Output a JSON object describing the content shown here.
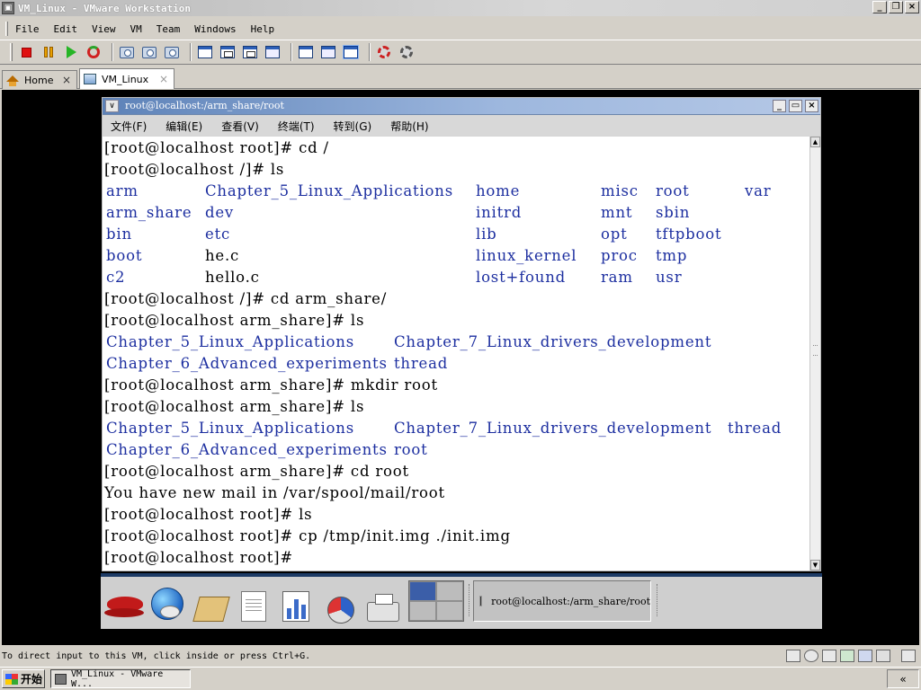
{
  "window": {
    "title": "VM_Linux - VMware Workstation",
    "controls": [
      "_",
      "❐",
      "×"
    ]
  },
  "menu": [
    {
      "id": "file",
      "label": "File"
    },
    {
      "id": "edit",
      "label": "Edit"
    },
    {
      "id": "view",
      "label": "View"
    },
    {
      "id": "vm",
      "label": "VM"
    },
    {
      "id": "team",
      "label": "Team"
    },
    {
      "id": "windows",
      "label": "Windows"
    },
    {
      "id": "help",
      "label": "Help"
    }
  ],
  "toolbar": {
    "icons": [
      "stop-icon",
      "pause-icon",
      "play-icon",
      "reset-icon",
      "snapshot-icon",
      "revert-snapshot-icon",
      "snapshot-manager-icon",
      "normal-view-icon",
      "full-screen-icon",
      "unity-icon",
      "quick-switch-icon",
      "console-view-icon",
      "summary-view-icon",
      "appliance-view-icon",
      "settings-icon",
      "team-settings-icon"
    ]
  },
  "tabs": [
    {
      "id": "home",
      "label": "Home",
      "close": "×"
    },
    {
      "id": "vm-linux",
      "label": "VM_Linux",
      "close": "×"
    }
  ],
  "guest": {
    "terminal": {
      "title": "root@localhost:/arm_share/root",
      "menu_button": "∨",
      "controls": [
        "_",
        "▭",
        "×"
      ],
      "menu": [
        "文件(F)",
        "编辑(E)",
        "查看(V)",
        "终端(T)",
        "转到(G)",
        "帮助(H)"
      ],
      "lines": [
        [
          {
            "text": "[root@localhost root]# cd /",
            "color": "default"
          }
        ],
        [
          {
            "text": "[root@localhost /]# ls",
            "color": "default"
          }
        ],
        [
          {
            "text": "arm",
            "color": "dir",
            "col": 0
          },
          {
            "text": "Chapter_5_Linux_Applications",
            "color": "dir",
            "col": 1
          },
          {
            "text": "home",
            "color": "dir",
            "col": 2
          },
          {
            "text": "misc",
            "color": "dir",
            "col": 3
          },
          {
            "text": "root",
            "color": "dir",
            "col": 4
          },
          {
            "text": "var",
            "color": "dir",
            "col": 5
          }
        ],
        [
          {
            "text": "arm_share",
            "color": "dir",
            "col": 0
          },
          {
            "text": "dev",
            "color": "dir",
            "col": 1
          },
          {
            "text": "initrd",
            "color": "dir",
            "col": 2
          },
          {
            "text": "mnt",
            "color": "dir",
            "col": 3
          },
          {
            "text": "sbin",
            "color": "dir",
            "col": 4
          }
        ],
        [
          {
            "text": "bin",
            "color": "dir",
            "col": 0
          },
          {
            "text": "etc",
            "color": "dir",
            "col": 1
          },
          {
            "text": "lib",
            "color": "dir",
            "col": 2
          },
          {
            "text": "opt",
            "color": "dir",
            "col": 3
          },
          {
            "text": "tftpboot",
            "color": "dir",
            "col": 4
          }
        ],
        [
          {
            "text": "boot",
            "color": "dir",
            "col": 0
          },
          {
            "text": "he.c",
            "color": "default",
            "col": 1
          },
          {
            "text": "linux_kernel",
            "color": "dir",
            "col": 2
          },
          {
            "text": "proc",
            "color": "dir",
            "col": 3
          },
          {
            "text": "tmp",
            "color": "dir",
            "col": 4
          }
        ],
        [
          {
            "text": "c2",
            "color": "dir",
            "col": 0
          },
          {
            "text": "hello.c",
            "color": "default",
            "col": 1
          },
          {
            "text": "lost+found",
            "color": "dir",
            "col": 2
          },
          {
            "text": "ram",
            "color": "dir",
            "col": 3
          },
          {
            "text": "usr",
            "color": "dir",
            "col": 4
          }
        ],
        [
          {
            "text": "[root@localhost /]# cd arm_share/",
            "color": "default"
          }
        ],
        [
          {
            "text": "[root@localhost arm_share]# ls",
            "color": "default"
          }
        ],
        [
          {
            "text": "Chapter_5_Linux_Applications",
            "color": "dir",
            "col": 0
          },
          {
            "text": "Chapter_7_Linux_drivers_development",
            "color": "dir",
            "col": 1
          }
        ],
        [
          {
            "text": "Chapter_6_Advanced_experiments",
            "color": "dir",
            "col": 0
          },
          {
            "text": "thread",
            "color": "dir",
            "col": 1
          }
        ],
        [
          {
            "text": "[root@localhost arm_share]# mkdir root",
            "color": "default"
          }
        ],
        [
          {
            "text": "[root@localhost arm_share]# ls",
            "color": "default"
          }
        ],
        [
          {
            "text": "Chapter_5_Linux_Applications",
            "color": "dir",
            "col": 0
          },
          {
            "text": "Chapter_7_Linux_drivers_development",
            "color": "dir",
            "col": 1
          },
          {
            "text": "thread",
            "color": "dir",
            "col": 2
          }
        ],
        [
          {
            "text": "Chapter_6_Advanced_experiments",
            "color": "dir",
            "col": 0
          },
          {
            "text": "root",
            "color": "dir",
            "col": 1
          }
        ],
        [
          {
            "text": "[root@localhost arm_share]# cd root",
            "color": "default"
          }
        ],
        [
          {
            "text": "You have new mail in /var/spool/mail/root",
            "color": "default"
          }
        ],
        [
          {
            "text": "[root@localhost root]# ls",
            "color": "default"
          }
        ],
        [
          {
            "text": "[root@localhost root]# cp /tmp/init.img ./init.img",
            "color": "default"
          }
        ],
        [
          {
            "text": "[root@localhost root]# ",
            "color": "default"
          }
        ]
      ]
    },
    "panel": {
      "launchers": [
        "redhat-menu-icon",
        "web-browser-icon",
        "email-icon",
        "writer-icon",
        "spreadsheet-icon",
        "presentation-icon",
        "print-manager-icon"
      ],
      "workspaces": 4,
      "active_workspace": 0,
      "task_label": "root@localhost:/arm_share/root"
    }
  },
  "status": {
    "text": "To direct input to this VM, click inside or press Ctrl+G.",
    "devices": [
      "hard-disk-icon",
      "cd-rom-icon",
      "floppy-icon",
      "network-icon",
      "usb-icon",
      "sound-icon",
      "message-log-icon"
    ]
  },
  "win_taskbar": {
    "start_label": "开始",
    "task_label": "VM_Linux - VMware W...",
    "tray": "«"
  },
  "colors": {
    "dir": "#1d2fa0",
    "default": "#000000",
    "titlebar": "#5d82b8",
    "panel_border": "#1d3b66"
  }
}
